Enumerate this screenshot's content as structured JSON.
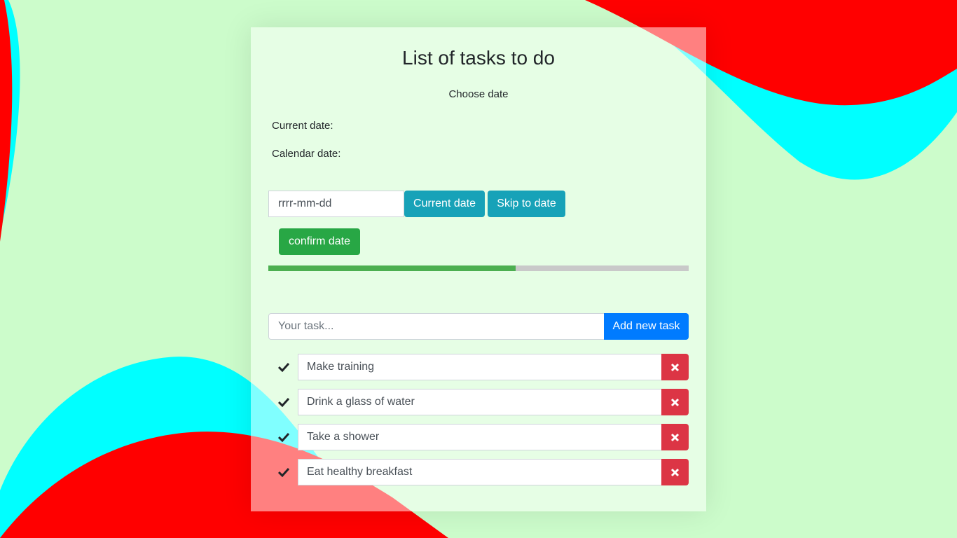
{
  "header": {
    "title": "List of tasks to do",
    "subtitle": "Choose date"
  },
  "date_info": {
    "current_label": "Current date:",
    "calendar_label": "Calendar date:"
  },
  "date_controls": {
    "input_placeholder": "rrrr-mm-dd",
    "current_button": "Current date",
    "skip_button": "Skip to date",
    "confirm_button": "confirm date"
  },
  "progress": {
    "value_percent": 58.8
  },
  "task_entry": {
    "placeholder": "Your task...",
    "add_button": "Add new task"
  },
  "tasks": [
    {
      "text": "Make training"
    },
    {
      "text": "Drink a glass of water"
    },
    {
      "text": "Take a shower"
    },
    {
      "text": "Eat healthy breakfast"
    }
  ],
  "icons": {
    "task_check": "check-icon",
    "task_delete": "close-icon"
  },
  "colors": {
    "background": "#ccfccb",
    "wave_red": "#ff0000",
    "wave_cyan": "#00ffff",
    "info_button": "#17a2b8",
    "confirm_button": "#28a745",
    "add_button": "#007bff",
    "delete_button": "#dc3545",
    "progress_fill": "#4caf50",
    "progress_track": "#c9c9c9"
  }
}
